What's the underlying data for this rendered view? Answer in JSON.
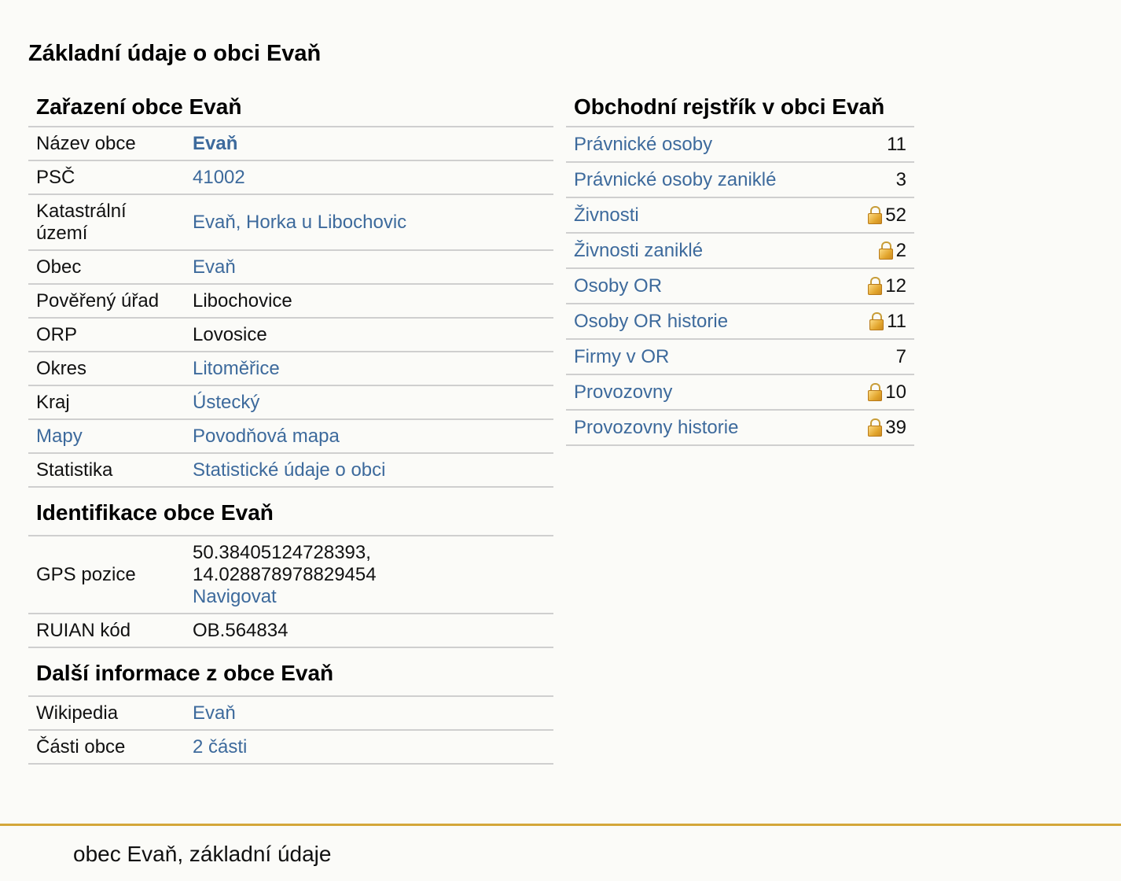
{
  "page_title": "Základní údaje o obci Evaň",
  "zarazeni": {
    "heading": "Zařazení obce Evaň",
    "rows": [
      {
        "key": "Název obce",
        "value": "Evaň"
      },
      {
        "key": "PSČ",
        "value": "41002"
      },
      {
        "key": "Katastrální území",
        "value_parts": [
          "Evaň",
          ", ",
          "Horka u Libochovic"
        ]
      },
      {
        "key": "Obec",
        "value": "Evaň"
      },
      {
        "key": "Pověřený úřad",
        "value": "Libochovice"
      },
      {
        "key": "ORP",
        "value": "Lovosice"
      },
      {
        "key": "Okres",
        "value": "Litoměřice"
      },
      {
        "key": "Kraj",
        "value": "Ústecký"
      },
      {
        "key": "Mapy",
        "value": "Povodňová mapa"
      },
      {
        "key": "Statistika",
        "value": "Statistické údaje o obci"
      }
    ]
  },
  "identifikace": {
    "heading": "Identifikace obce Evaň",
    "gps_label": "GPS pozice",
    "gps_value": "50.38405124728393,",
    "gps_value2": "14.028878978829454",
    "gps_link": "Navigovat",
    "ruian_label": "RUIAN kód",
    "ruian_value": "OB.564834"
  },
  "dalsi": {
    "heading": "Další informace z obce Evaň",
    "rows": [
      {
        "key": "Wikipedia",
        "value": "Evaň"
      },
      {
        "key": "Části obce",
        "value": "2 části"
      }
    ]
  },
  "rejstrik": {
    "heading": "Obchodní rejstřík v obci Evaň",
    "rows": [
      {
        "label": "Právnické osoby",
        "count": "11",
        "locked": false
      },
      {
        "label": "Právnické osoby zaniklé",
        "count": "3",
        "locked": false
      },
      {
        "label": "Živnosti",
        "count": "52",
        "locked": true,
        "icon": "lock-icon"
      },
      {
        "label": "Živnosti zaniklé",
        "count": "2",
        "locked": true,
        "icon": "lock-icon"
      },
      {
        "label": "Osoby OR",
        "count": "12",
        "locked": true,
        "icon": "lock-icon"
      },
      {
        "label": "Osoby OR historie",
        "count": "11",
        "locked": true,
        "icon": "lock-icon"
      },
      {
        "label": "Firmy v OR",
        "count": "7",
        "locked": false
      },
      {
        "label": "Provozovny",
        "count": "10",
        "locked": true,
        "icon": "lock-icon"
      },
      {
        "label": "Provozovny historie",
        "count": "39",
        "locked": true,
        "icon": "lock-icon"
      }
    ]
  },
  "footer": {
    "text": "obec Evaň, základní údaje"
  },
  "colors": {
    "link": "#3d6a9c",
    "footer_rule": "#d4a73a",
    "lock": "#e2a52d",
    "border": "#cfcfcf",
    "background": "#fbfbf8"
  }
}
